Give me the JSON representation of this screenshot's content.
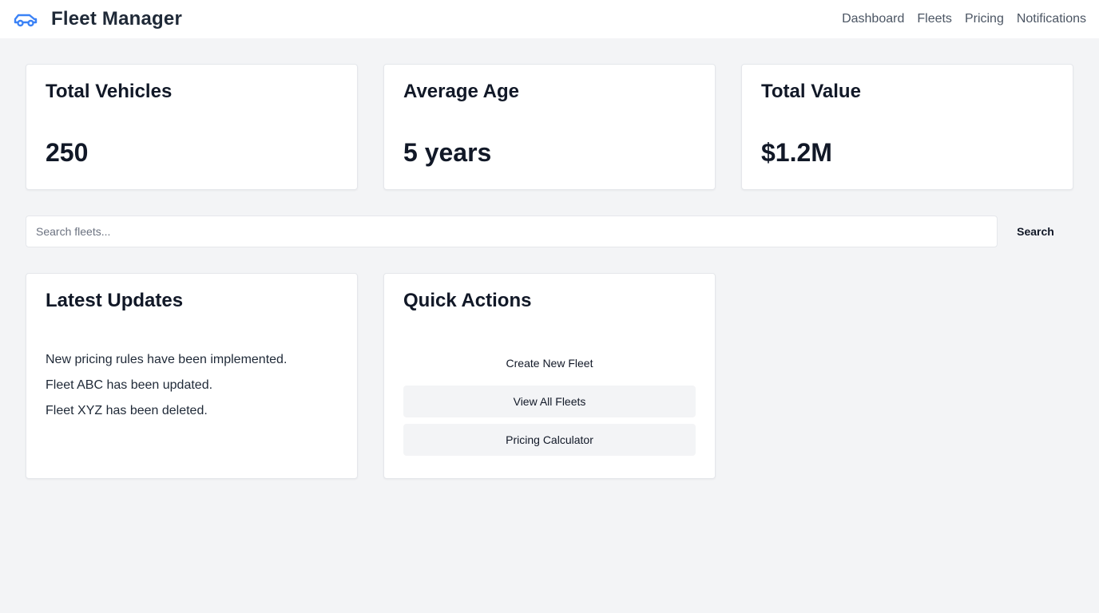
{
  "header": {
    "title": "Fleet Manager",
    "logo_icon": "car-icon",
    "accent_color": "#3b82f6",
    "nav": [
      {
        "label": "Dashboard"
      },
      {
        "label": "Fleets"
      },
      {
        "label": "Pricing"
      },
      {
        "label": "Notifications"
      }
    ]
  },
  "stats": [
    {
      "title": "Total Vehicles",
      "value": "250"
    },
    {
      "title": "Average Age",
      "value": "5 years"
    },
    {
      "title": "Total Value",
      "value": "$1.2M"
    }
  ],
  "search": {
    "placeholder": "Search fleets...",
    "value": "",
    "button_label": "Search"
  },
  "updates": {
    "title": "Latest Updates",
    "items": [
      "New pricing rules have been implemented.",
      "Fleet ABC has been updated.",
      "Fleet XYZ has been deleted."
    ]
  },
  "quick_actions": {
    "title": "Quick Actions",
    "buttons": [
      {
        "label": "Create New Fleet"
      },
      {
        "label": "View All Fleets"
      },
      {
        "label": "Pricing Calculator"
      }
    ]
  }
}
